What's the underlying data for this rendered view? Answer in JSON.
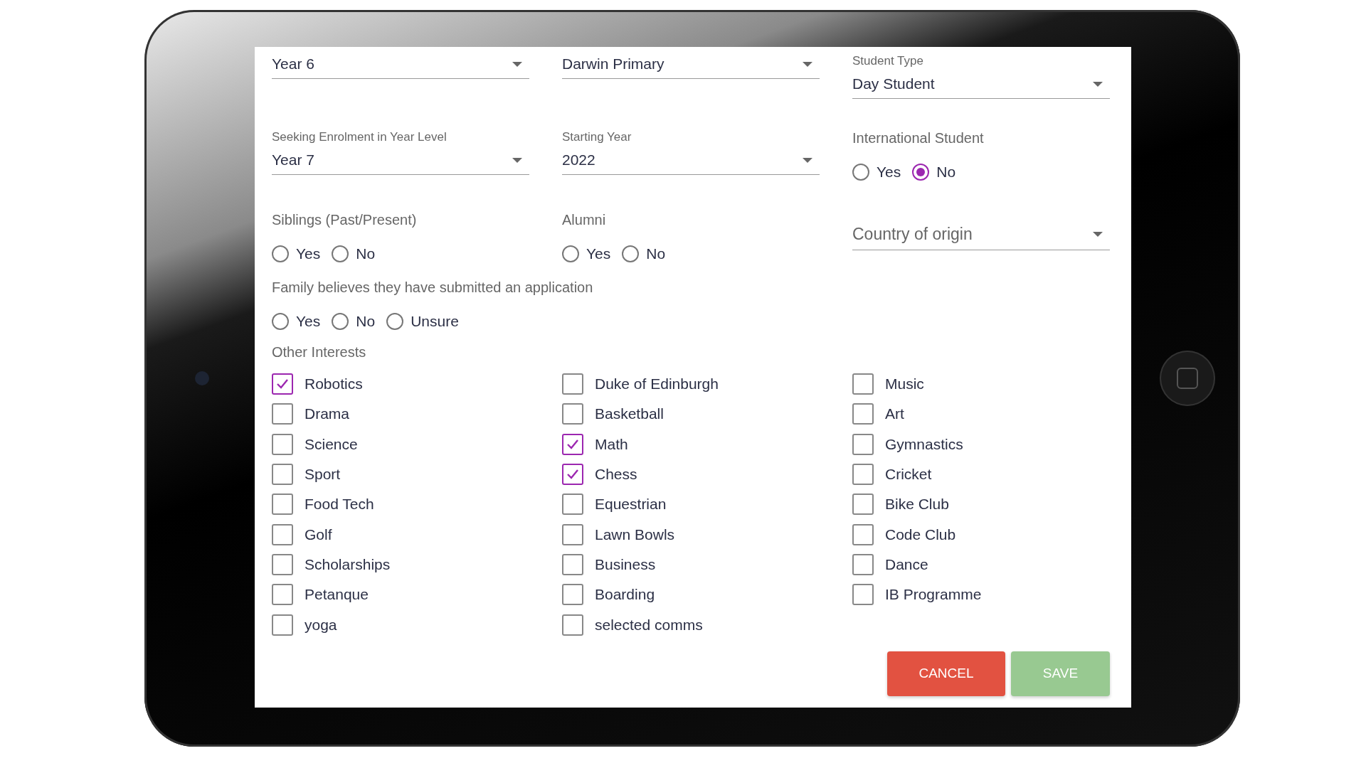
{
  "fields": [
    {
      "kind": "select",
      "value": "Year 6"
    },
    {
      "kind": "select",
      "value": "Darwin Primary"
    },
    {
      "kind": "select",
      "label": "Student Type",
      "value": "Day Student"
    },
    {
      "kind": "select",
      "label": "Seeking Enrolment in Year Level",
      "value": "Year 7"
    },
    {
      "kind": "select",
      "label": "Starting Year",
      "value": "2022"
    },
    {
      "kind": "radio",
      "label": "International Student",
      "options": [
        {
          "label": "Yes",
          "selected": false
        },
        {
          "label": "No",
          "selected": true
        }
      ]
    },
    {
      "kind": "radio",
      "label": "Siblings (Past/Present)",
      "options": [
        {
          "label": "Yes",
          "selected": false
        },
        {
          "label": "No",
          "selected": false
        }
      ]
    },
    {
      "kind": "radio",
      "label": "Alumni",
      "options": [
        {
          "label": "Yes",
          "selected": false
        },
        {
          "label": "No",
          "selected": false
        }
      ]
    },
    {
      "kind": "select",
      "placeholder": "Country of origin"
    }
  ],
  "application": {
    "label": "Family believes they have submitted an application",
    "options": [
      {
        "label": "Yes",
        "selected": false
      },
      {
        "label": "No",
        "selected": false
      },
      {
        "label": "Unsure",
        "selected": false
      }
    ]
  },
  "interests": {
    "title": "Other Interests",
    "columns": [
      [
        {
          "label": "Robotics",
          "checked": true
        },
        {
          "label": "Drama",
          "checked": false
        },
        {
          "label": "Science",
          "checked": false
        },
        {
          "label": "Sport",
          "checked": false
        },
        {
          "label": "Food Tech",
          "checked": false
        },
        {
          "label": "Golf",
          "checked": false
        },
        {
          "label": "Scholarships",
          "checked": false
        },
        {
          "label": "Petanque",
          "checked": false
        },
        {
          "label": "yoga",
          "checked": false
        }
      ],
      [
        {
          "label": "Duke of Edinburgh",
          "checked": false
        },
        {
          "label": "Basketball",
          "checked": false
        },
        {
          "label": "Math",
          "checked": true
        },
        {
          "label": "Chess",
          "checked": true
        },
        {
          "label": "Equestrian",
          "checked": false
        },
        {
          "label": "Lawn Bowls",
          "checked": false
        },
        {
          "label": "Business",
          "checked": false
        },
        {
          "label": "Boarding",
          "checked": false
        },
        {
          "label": "selected comms",
          "checked": false
        }
      ],
      [
        {
          "label": "Music",
          "checked": false
        },
        {
          "label": "Art",
          "checked": false
        },
        {
          "label": "Gymnastics",
          "checked": false
        },
        {
          "label": "Cricket",
          "checked": false
        },
        {
          "label": "Bike Club",
          "checked": false
        },
        {
          "label": "Code Club",
          "checked": false
        },
        {
          "label": "Dance",
          "checked": false
        },
        {
          "label": "IB Programme",
          "checked": false
        }
      ]
    ]
  },
  "buttons": [
    {
      "kind": "cancel",
      "label": "CANCEL",
      "disabled": false
    },
    {
      "kind": "save",
      "label": "SAVE",
      "disabled": true
    }
  ]
}
